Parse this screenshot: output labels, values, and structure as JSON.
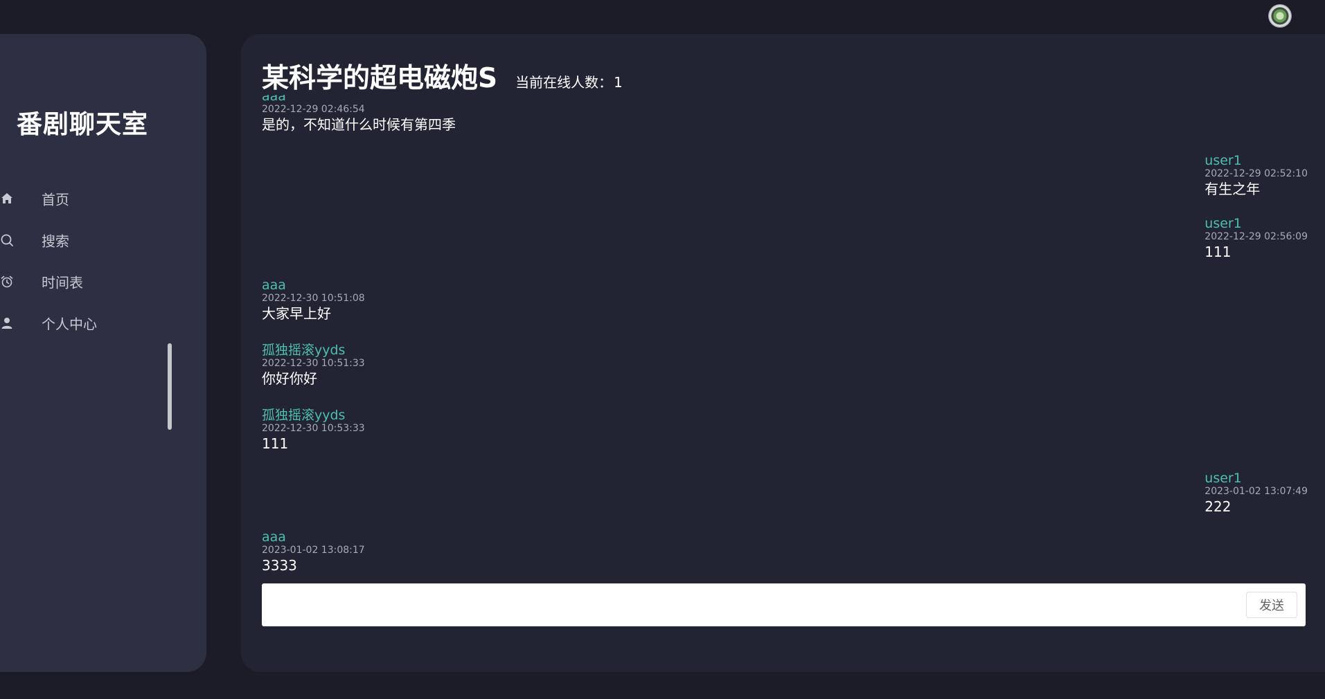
{
  "app": {
    "brand": "番剧聊天室"
  },
  "sidebar": {
    "items": [
      {
        "label": "首页",
        "icon": "home-icon"
      },
      {
        "label": "搜索",
        "icon": "search-icon"
      },
      {
        "label": "时间表",
        "icon": "alarm-clock-icon"
      },
      {
        "label": "个人中心",
        "icon": "user-icon"
      }
    ]
  },
  "room": {
    "title": "某科学的超电磁炮S",
    "online_label": "当前在线人数：",
    "online_count": "1"
  },
  "messages": [
    {
      "user": "aaa",
      "time": "2022-12-29 02:46:54",
      "text": "是的，不知道什么时候有第四季",
      "side": "left"
    },
    {
      "user": "user1",
      "time": "2022-12-29 02:52:10",
      "text": "有生之年",
      "side": "right"
    },
    {
      "user": "user1",
      "time": "2022-12-29 02:56:09",
      "text": "111",
      "side": "right"
    },
    {
      "user": "aaa",
      "time": "2022-12-30 10:51:08",
      "text": "大家早上好",
      "side": "left"
    },
    {
      "user": "孤独摇滚yyds",
      "time": "2022-12-30 10:51:33",
      "text": "你好你好",
      "side": "left"
    },
    {
      "user": "孤独摇滚yyds",
      "time": "2022-12-30 10:53:33",
      "text": "111",
      "side": "left"
    },
    {
      "user": "user1",
      "time": "2023-01-02 13:07:49",
      "text": "222",
      "side": "right"
    },
    {
      "user": "aaa",
      "time": "2023-01-02 13:08:17",
      "text": "3333",
      "side": "left"
    }
  ],
  "composer": {
    "value": "",
    "send_label": "发送"
  },
  "colors": {
    "background": "#1c1c28",
    "sidebar": "#2d2f42",
    "main": "#222433",
    "username": "#4fbfad"
  }
}
